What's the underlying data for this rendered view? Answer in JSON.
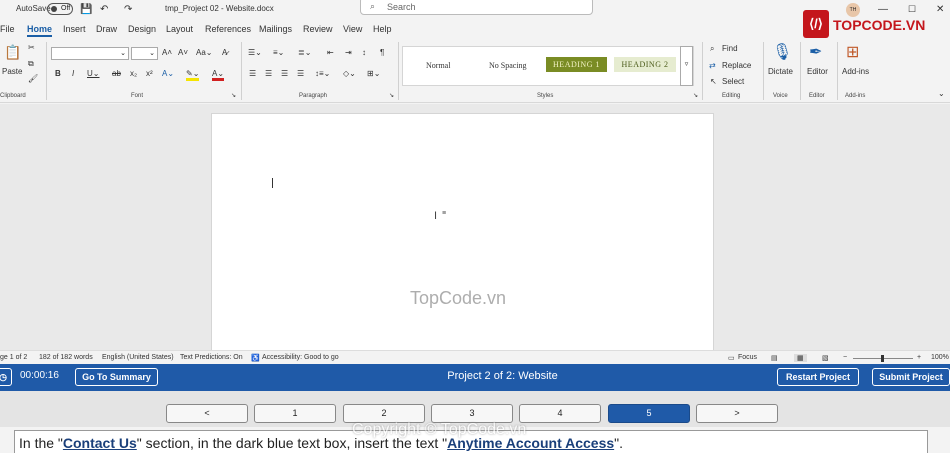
{
  "titlebar": {
    "autosave_label": "AutoSave",
    "autosave_state": "Off",
    "filename": "tmp_Project 02 - Website.docx",
    "search_placeholder": "Search",
    "user_initials": "TH"
  },
  "logo": {
    "text": "TOPCODE.VN"
  },
  "tabs": [
    "File",
    "Home",
    "Insert",
    "Draw",
    "Design",
    "Layout",
    "References",
    "Mailings",
    "Review",
    "View",
    "Help"
  ],
  "ribbon": {
    "clipboard": {
      "paste": "Paste",
      "label": "Clipboard"
    },
    "font": {
      "label": "Font"
    },
    "paragraph": {
      "label": "Paragraph"
    },
    "styles": {
      "label": "Styles",
      "items": [
        "Normal",
        "No Spacing",
        "HEADING 1",
        "HEADING 2"
      ]
    },
    "editing": {
      "find": "Find",
      "replace": "Replace",
      "select": "Select",
      "label": "Editing"
    },
    "voice": {
      "dictate": "Dictate",
      "label": "Voice"
    },
    "editor": {
      "editor": "Editor",
      "label": "Editor"
    },
    "addins": {
      "addins": "Add-ins",
      "label": "Add-ins"
    }
  },
  "document": {
    "watermark": "TopCode.vn"
  },
  "statusbar": {
    "page": "ge 1 of 2",
    "words": "182 of 182 words",
    "language": "English (United States)",
    "predictions": "Text Predictions: On",
    "accessibility": "Accessibility: Good to go",
    "focus": "Focus",
    "zoom": "100%"
  },
  "sim": {
    "timer": "00:00:16",
    "summary": "Go To Summary",
    "title": "Project 2 of 2: Website",
    "restart": "Restart Project",
    "submit": "Submit Project"
  },
  "pager": {
    "prev": "<",
    "pages": [
      "1",
      "2",
      "3",
      "4",
      "5"
    ],
    "active_page": "5",
    "next": ">"
  },
  "instruction": {
    "part1": "In the \"",
    "link1": "Contact Us",
    "part2": "\" section, in the dark blue text box, insert the text \"",
    "link2": "Anytime Account Access",
    "part3": "\"."
  },
  "copyright": "Copyright © TopCode.vn",
  "colors": {
    "sim_blue": "#1f5aa8",
    "heading1_bg": "#7a8c24",
    "accent": "#1a5ea6"
  }
}
